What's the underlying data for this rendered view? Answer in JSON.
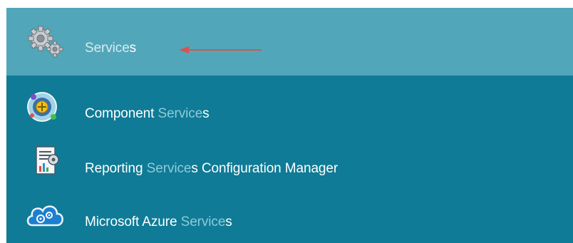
{
  "results": [
    {
      "label_parts": [
        {
          "text": "Service",
          "highlight": true
        },
        {
          "text": "s",
          "highlight": false
        }
      ],
      "icon": "gears-icon",
      "selected": true
    },
    {
      "label_parts": [
        {
          "text": "Component ",
          "highlight": false
        },
        {
          "text": "Service",
          "highlight": true
        },
        {
          "text": "s",
          "highlight": false
        }
      ],
      "icon": "component-services-icon",
      "selected": false
    },
    {
      "label_parts": [
        {
          "text": "Reporting ",
          "highlight": false
        },
        {
          "text": "Service",
          "highlight": true
        },
        {
          "text": "s Configuration Manager",
          "highlight": false
        }
      ],
      "icon": "report-config-icon",
      "selected": false
    },
    {
      "label_parts": [
        {
          "text": "Microsoft Azure ",
          "highlight": false
        },
        {
          "text": "Service",
          "highlight": true
        },
        {
          "text": "s",
          "highlight": false
        }
      ],
      "icon": "azure-cloud-icon",
      "selected": false
    }
  ],
  "colors": {
    "panel_background": "#0f7b96",
    "selected_background": "#52a6b9",
    "highlight_text": "#8fcad8",
    "arrow": "#d9534f"
  }
}
